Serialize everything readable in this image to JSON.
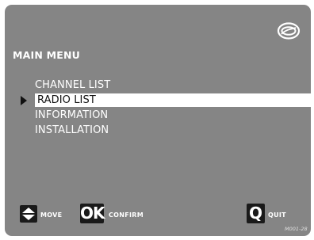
{
  "menu": {
    "title": "MAIN MENU",
    "items": [
      {
        "label": "CHANNEL LIST",
        "selected": false
      },
      {
        "label": "RADIO LIST",
        "selected": true
      },
      {
        "label": "INFORMATION",
        "selected": false
      },
      {
        "label": "INSTALLATION",
        "selected": false
      }
    ]
  },
  "footer": {
    "move_label": "MOVE",
    "ok_key": "OK",
    "confirm_label": "CONFIRM",
    "quit_key": "Q",
    "quit_label": "QUIT",
    "code": "M001-28"
  },
  "icons": {
    "logo": "brand-logo-icon",
    "cursor": "triangle-right-icon",
    "move": "up-down-arrows-icon"
  },
  "colors": {
    "screen_background": "#858585",
    "selection_bar": "#ffffff",
    "text": "#ffffff",
    "key_background": "#1a1a1a"
  }
}
